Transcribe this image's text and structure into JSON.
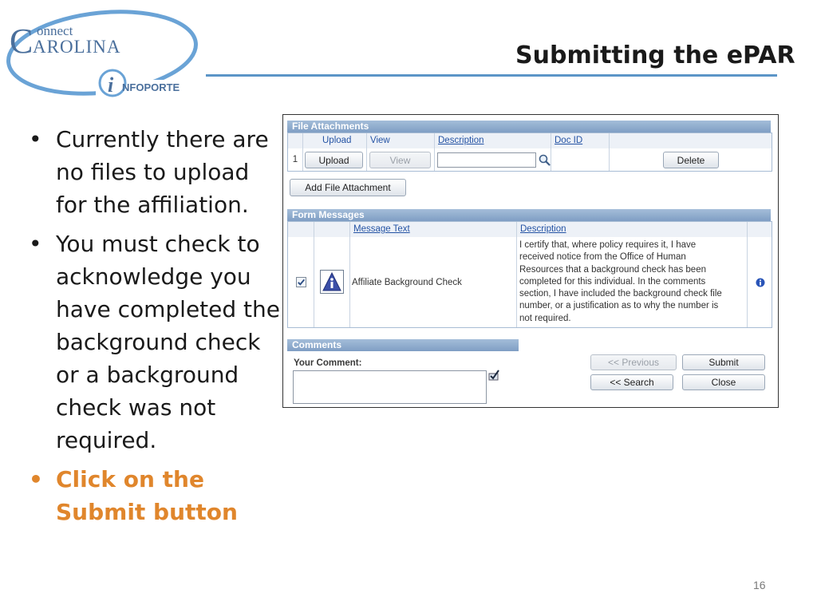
{
  "logo": {
    "connect": "onnect",
    "c_letter": "C",
    "carolina": "AROLINA",
    "i_letter": "i",
    "infoporte": "NFOPORTE"
  },
  "slide": {
    "title": "Submitting the ePAR",
    "page_number": "16"
  },
  "bullets": [
    {
      "text": "Currently there are no files to upload for the affiliation.",
      "highlight": false
    },
    {
      "text": "You must check to acknowledge you have completed the background check or a background check was not required.",
      "highlight": false
    },
    {
      "text": "Click on the Submit button",
      "highlight": true
    }
  ],
  "bullet_glyph": "•",
  "colors": {
    "highlight": "#e0862c",
    "rule": "#5c95c7",
    "header_blue": "#7f9ec4",
    "link_blue": "#2453a4"
  },
  "file_attachments": {
    "header": "File Attachments",
    "columns": {
      "upload": "Upload",
      "view": "View",
      "description": "Description",
      "doc_id": "Doc ID"
    },
    "row": {
      "index": "1",
      "upload_button": "Upload",
      "view_button": "View",
      "description_value": "",
      "delete_button": "Delete"
    },
    "add_button": "Add File Attachment"
  },
  "form_messages": {
    "header": "Form Messages",
    "columns": {
      "message_text": "Message Text",
      "description": "Description"
    },
    "row": {
      "checked": true,
      "message": "Affiliate Background Check",
      "description_lines": [
        "I certify that, where policy requires it, I have",
        "received notice from the Office of Human",
        "Resources that a background check has been",
        "completed for this individual.  In the comments",
        "section, I have included the background check file",
        "number, or a justification as to why the number is",
        "not required."
      ]
    }
  },
  "comments": {
    "header": "Comments",
    "label": "Your Comment:",
    "value": ""
  },
  "actions": {
    "previous": "<< Previous",
    "submit": "Submit",
    "search": "<< Search",
    "close": "Close"
  }
}
